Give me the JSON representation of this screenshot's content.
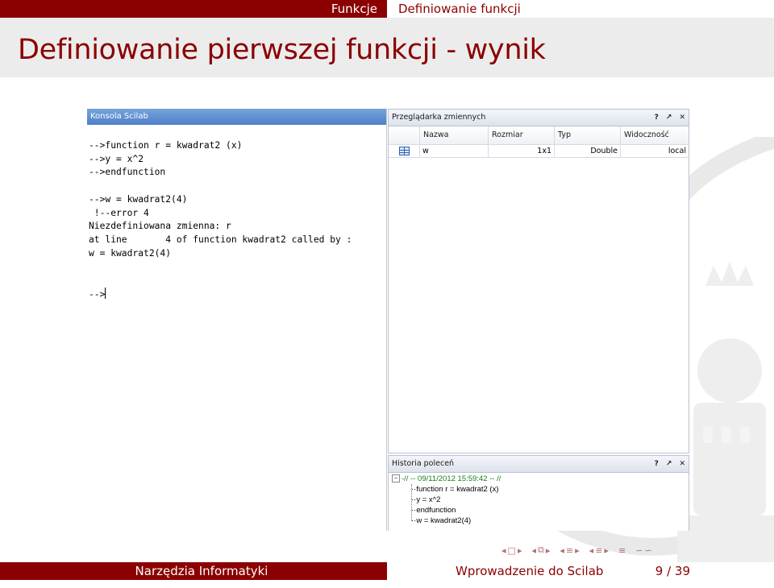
{
  "nav": {
    "section": "Funkcje",
    "subsection": "Definiowanie funkcji"
  },
  "frame": {
    "title": "Definiowanie pierwszej funkcji - wynik"
  },
  "console": {
    "title": "Konsola Scilab",
    "lines": [
      "-->function r = kwadrat2 (x)",
      "-->y = x^2",
      "-->endfunction",
      "",
      "-->w = kwadrat2(4)",
      " !--error 4",
      "Niezdefiniowana zmienna: r",
      "at line       4 of function kwadrat2 called by :",
      "w = kwadrat2(4)",
      "",
      "",
      "-->"
    ]
  },
  "variables": {
    "title": "Przeglądarka zmiennych",
    "controls": [
      "?",
      "↗",
      "✕"
    ],
    "columns": [
      "Nazwa",
      "Rozmiar",
      "Typ",
      "Widoczność"
    ],
    "rows": [
      {
        "name": "w",
        "size": "1x1",
        "type": "Double",
        "visibility": "local"
      }
    ]
  },
  "history": {
    "title": "Historia poleceń",
    "controls": [
      "?",
      "↗",
      "✕"
    ],
    "root": "-// -- 09/11/2012 15:59:42 -- //",
    "entries": [
      "function r = kwadrat2 (x)",
      "y = x^2",
      "endfunction",
      "w = kwadrat2(4)"
    ]
  },
  "footer": {
    "left": "Narzędzia Informatyki",
    "right": "Wprowadzenie do Scilab",
    "page": "9 / 39"
  },
  "colors": {
    "accent": "#8b0000",
    "title_bg": "#ececec"
  }
}
